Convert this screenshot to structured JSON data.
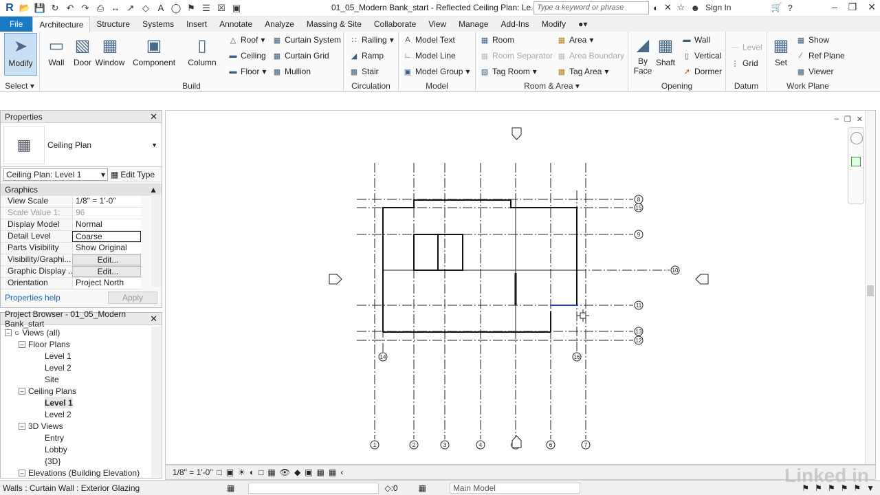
{
  "titlebar": {
    "document_title": "01_05_Modern Bank_start - Reflected Ceiling Plan: Le...",
    "search_placeholder": "Type a keyword or phrase",
    "sign_in": "Sign In"
  },
  "tabs": [
    "File",
    "Architecture",
    "Structure",
    "Systems",
    "Insert",
    "Annotate",
    "Analyze",
    "Massing & Site",
    "Collaborate",
    "View",
    "Manage",
    "Add-Ins",
    "Modify"
  ],
  "active_tab": "Architecture",
  "ribbon": {
    "select_panel": {
      "modify": "Modify",
      "label": "Select ▾"
    },
    "build": {
      "label": "Build",
      "big": [
        "Wall",
        "Door",
        "Window",
        "Component",
        "Column"
      ],
      "roof": "Roof",
      "ceiling": "Ceiling",
      "floor": "Floor",
      "curtain_system": "Curtain System",
      "curtain_grid": "Curtain Grid",
      "mullion": "Mullion"
    },
    "circulation": {
      "label": "Circulation",
      "railing": "Railing",
      "ramp": "Ramp",
      "stair": "Stair"
    },
    "model": {
      "label": "Model",
      "text": "Model  Text",
      "line": "Model  Line",
      "group": "Model  Group"
    },
    "room_area": {
      "label": "Room & Area",
      "room": "Room",
      "room_separator": "Room  Separator",
      "tag_room": "Tag  Room",
      "area": "Area",
      "area_boundary": "Area  Boundary",
      "tag_area": "Tag  Area"
    },
    "opening": {
      "label": "Opening",
      "by_face": "By Face",
      "shaft": "Shaft",
      "wall": "Wall",
      "vertical": "Vertical",
      "dormer": "Dormer"
    },
    "datum": {
      "label": "Datum",
      "level": "Level",
      "grid": "Grid"
    },
    "work_plane": {
      "label": "Work Plane",
      "set": "Set",
      "show": "Show",
      "ref_plane": "Ref  Plane",
      "viewer": "Viewer"
    }
  },
  "properties": {
    "title": "Properties",
    "type_name": "Ceiling Plan",
    "instance_selector": "Ceiling Plan: Level 1",
    "edit_type": "Edit Type",
    "section": "Graphics",
    "rows": [
      {
        "k": "View Scale",
        "v": "1/8\" = 1'-0\""
      },
      {
        "k": "Scale Value    1:",
        "v": "96"
      },
      {
        "k": "Display Model",
        "v": "Normal"
      },
      {
        "k": "Detail Level",
        "v": "Coarse"
      },
      {
        "k": "Parts Visibility",
        "v": "Show Original"
      },
      {
        "k": "Visibility/Graphi...",
        "v": "Edit..."
      },
      {
        "k": "Graphic Display ...",
        "v": "Edit..."
      },
      {
        "k": "Orientation",
        "v": "Project North"
      }
    ],
    "help": "Properties help",
    "apply": "Apply"
  },
  "browser": {
    "title": "Project Browser - 01_05_Modern Bank_start",
    "items": [
      {
        "label": "Views (all)"
      },
      {
        "label": "Floor Plans"
      },
      {
        "label": "Level 1"
      },
      {
        "label": "Level 2"
      },
      {
        "label": "Site"
      },
      {
        "label": "Ceiling Plans"
      },
      {
        "label": "Level 1"
      },
      {
        "label": "Level 2"
      },
      {
        "label": "3D Views"
      },
      {
        "label": "Entry"
      },
      {
        "label": "Lobby"
      },
      {
        "label": "{3D}"
      },
      {
        "label": "Elevations (Building Elevation)"
      }
    ]
  },
  "drawing": {
    "grid_bottom": [
      "1",
      "2",
      "3",
      "4",
      "5",
      "6",
      "7"
    ],
    "grid_right": [
      "8",
      "15",
      "9",
      "10",
      "11",
      "13",
      "12"
    ],
    "grid_other": [
      "14",
      "16"
    ]
  },
  "viewbar": {
    "scale": "1/8\" = 1'-0\""
  },
  "statusbar": {
    "text": "Walls : Curtain Wall : Exterior Glazing",
    "count": ":0",
    "model": "Main Model"
  },
  "watermark": "Linked in"
}
